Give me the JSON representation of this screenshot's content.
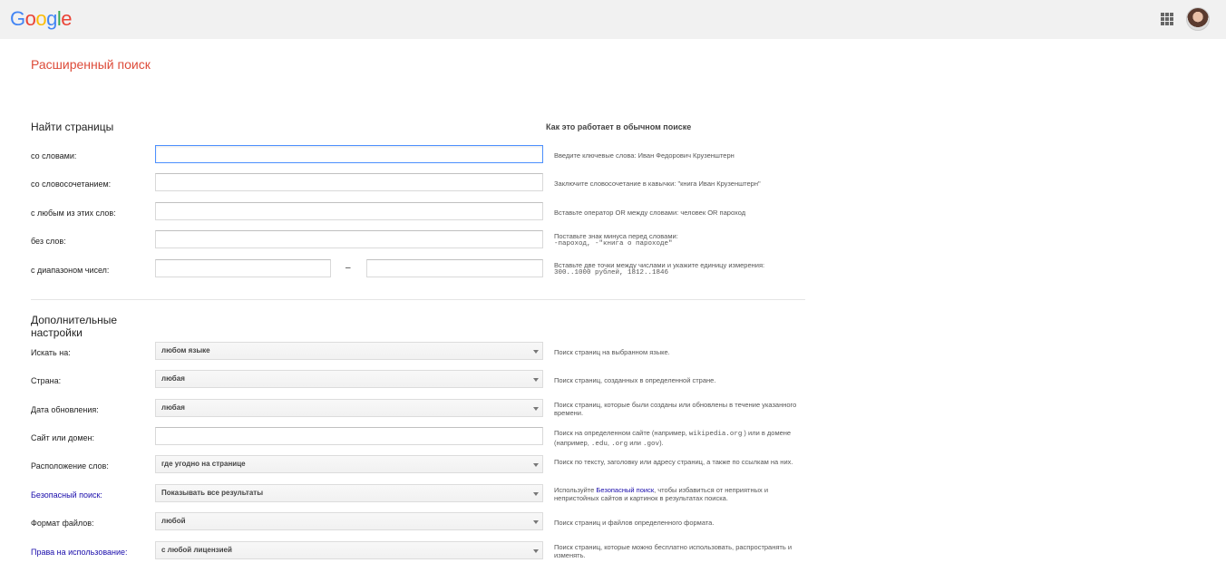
{
  "header": {
    "logo": {
      "letters": [
        {
          "ch": "G",
          "color": "#4285f4"
        },
        {
          "ch": "o",
          "color": "#ea4335"
        },
        {
          "ch": "o",
          "color": "#fbbc05"
        },
        {
          "ch": "g",
          "color": "#4285f4"
        },
        {
          "ch": "l",
          "color": "#34a853"
        },
        {
          "ch": "e",
          "color": "#ea4335"
        }
      ]
    },
    "icons": [
      "apps-icon",
      "avatar"
    ]
  },
  "page_title": "Расширенный поиск",
  "find": {
    "title": "Найти страницы",
    "how_title": "Как это работает в обычном поиске",
    "all_words": {
      "label": "со словами:",
      "value": "",
      "help": "Введите ключевые слова: Иван Федорович Крузенштерн"
    },
    "phrase": {
      "label": "со словосочетанием:",
      "value": "",
      "help": "Заключите словосочетание в кавычки: \"книга Иван Крузенштерн\""
    },
    "any_words": {
      "label": "с любым из этих слов:",
      "value": "",
      "help": "Вставьте оператор OR между словами: человек OR пароход"
    },
    "none_words": {
      "label": "без слов:",
      "value": "",
      "help_line1": "Поставьте знак минуса перед словами:",
      "help_line2": "-пароход, -\"книга о пароходе\""
    },
    "range": {
      "label": "с диапазоном чисел:",
      "from": "",
      "to": "",
      "dash": "–",
      "help_line1": "Вставьте две точки между числами и укажите единицу измерения:",
      "help_line2": "300..1000 рублей, 1812..1846"
    }
  },
  "extra": {
    "title_line1": "Дополнительные",
    "title_line2": "настройки",
    "rows": {
      "language": {
        "label": "Искать на:",
        "value": "любом языке",
        "help": "Поиск страниц на выбранном языке."
      },
      "country": {
        "label": "Страна:",
        "value": "любая",
        "help": "Поиск страниц, созданных в определенной стране."
      },
      "updated": {
        "label": "Дата обновления:",
        "value": "любая",
        "help": "Поиск страниц, которые были созданы или обновлены в течение указанного времени."
      },
      "site": {
        "label": "Сайт или домен:",
        "value": "",
        "help_pre": "Поиск на определенном сайте (например, ",
        "help_mono1": "wikipedia.org",
        "help_mid": " ) или в домене (например, ",
        "help_mono2": ".edu",
        "help_sep": ", ",
        "help_mono3": ".org",
        "help_or": " или ",
        "help_mono4": ".gov",
        "help_post": ")."
      },
      "occurrence": {
        "label": "Расположение слов:",
        "value": "где угодно на странице",
        "help": "Поиск по тексту, заголовку или адресу страниц, а также по ссылкам на них."
      },
      "safesearch": {
        "label": "Безопасный поиск:",
        "value": "Показывать все результаты",
        "help_pre": "Используйте ",
        "help_link": "Безопасный поиск",
        "help_post": ", чтобы избавиться от неприятных и непристойных сайтов и картинок в результатах поиска."
      },
      "filetype": {
        "label": "Формат файлов:",
        "value": "любой",
        "help": "Поиск страниц и файлов определенного формата."
      },
      "rights": {
        "label": "Права на использование:",
        "value": "с любой лицензией",
        "help": "Поиск страниц, которые можно бесплатно использовать, распространять и изменять."
      }
    }
  }
}
